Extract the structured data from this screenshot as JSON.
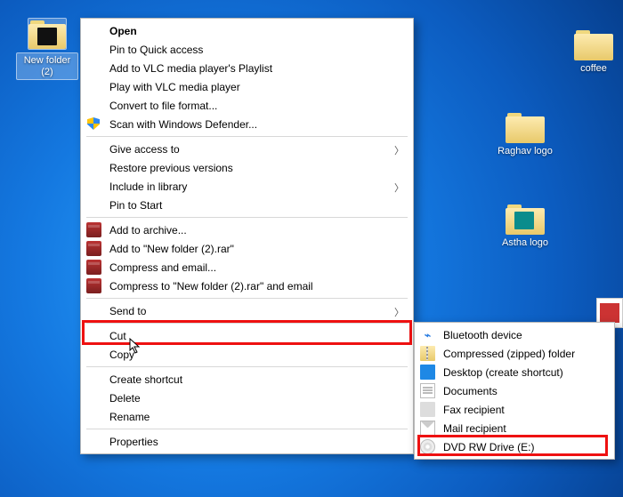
{
  "desktop_icons": {
    "new_folder": "New folder (2)",
    "coffee": "coffee",
    "raghav": "Raghav logo",
    "astha": "Astha logo"
  },
  "menu": {
    "open": "Open",
    "pin_quick": "Pin to Quick access",
    "vlc_playlist": "Add to VLC media player's Playlist",
    "vlc_play": "Play with VLC media player",
    "convert": "Convert to file format...",
    "defender": "Scan with Windows Defender...",
    "give_access": "Give access to",
    "restore": "Restore previous versions",
    "include_lib": "Include in library",
    "pin_start": "Pin to Start",
    "add_archive": "Add to archive...",
    "add_rar": "Add to \"New folder (2).rar\"",
    "compress_email": "Compress and email...",
    "compress_rar_email": "Compress to \"New folder (2).rar\" and email",
    "send_to": "Send to",
    "cut": "Cut",
    "copy": "Copy",
    "create_shortcut": "Create shortcut",
    "delete": "Delete",
    "rename": "Rename",
    "properties": "Properties"
  },
  "submenu": {
    "bluetooth": "Bluetooth device",
    "compressed": "Compressed (zipped) folder",
    "desktop_shortcut": "Desktop (create shortcut)",
    "documents": "Documents",
    "fax": "Fax recipient",
    "mail": "Mail recipient",
    "dvd": "DVD RW Drive (E:)"
  }
}
